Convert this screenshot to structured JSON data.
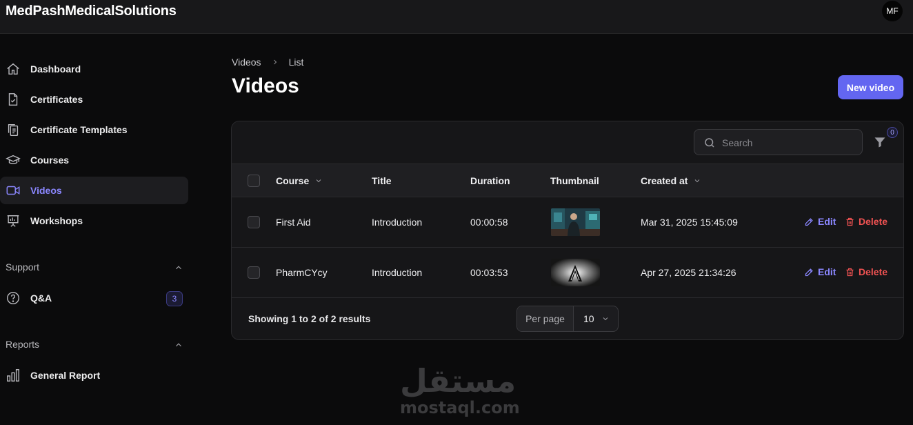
{
  "app": {
    "brand": "MedPashMedicalSolutions",
    "avatar_initials": "MF"
  },
  "sidebar": {
    "items": [
      {
        "label": "Dashboard",
        "icon": "home-icon"
      },
      {
        "label": "Certificates",
        "icon": "document-check-icon"
      },
      {
        "label": "Certificate Templates",
        "icon": "clipboard-document-icon"
      },
      {
        "label": "Courses",
        "icon": "academic-cap-icon"
      },
      {
        "label": "Videos",
        "icon": "video-camera-icon",
        "active": true
      },
      {
        "label": "Workshops",
        "icon": "presentation-chart-icon"
      }
    ],
    "support": {
      "title": "Support",
      "items": [
        {
          "label": "Q&A",
          "icon": "question-circle-icon",
          "badge": "3"
        }
      ]
    },
    "reports": {
      "title": "Reports",
      "items": [
        {
          "label": "General Report",
          "icon": "bar-chart-icon"
        }
      ]
    }
  },
  "breadcrumb": {
    "items": [
      "Videos",
      "List"
    ]
  },
  "page": {
    "title": "Videos",
    "new_button": "New video"
  },
  "table": {
    "search_placeholder": "Search",
    "filter_count": "0",
    "columns": [
      "Course",
      "Title",
      "Duration",
      "Thumbnail",
      "Created at"
    ],
    "rows": [
      {
        "course": "First Aid",
        "title": "Introduction",
        "duration": "00:00:58",
        "created_at": "Mar 31, 2025 15:45:09",
        "edit": "Edit",
        "delete": "Delete"
      },
      {
        "course": "PharmCYcy",
        "title": "Introduction",
        "duration": "00:03:53",
        "created_at": "Apr 27, 2025 21:34:26",
        "edit": "Edit",
        "delete": "Delete"
      }
    ],
    "footer": {
      "summary": "Showing 1 to 2 of 2 results",
      "per_page_label": "Per page",
      "per_page_value": "10"
    }
  },
  "watermark": {
    "arabic": "مستقل",
    "latin": "mostaql.com"
  },
  "colors": {
    "accent": "#6366f1",
    "accent_text": "#8b87ff",
    "danger": "#f05252",
    "background": "#0b0b0c"
  }
}
